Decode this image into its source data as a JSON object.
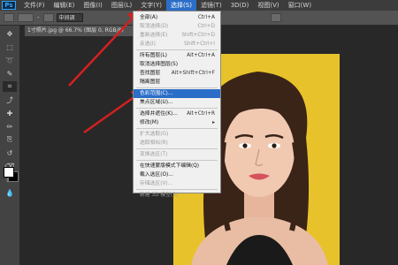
{
  "app_logo": "Ps",
  "menubar": {
    "items": [
      "文件(F)",
      "编辑(E)",
      "图像(I)",
      "图层(L)",
      "文字(Y)",
      "选择(S)",
      "滤镜(T)",
      "3D(D)",
      "视图(V)",
      "窗口(W)"
    ],
    "active_index": 5
  },
  "options_bar": {
    "size_label": "-",
    "mode_value": "中间调"
  },
  "document": {
    "tab_label": "1寸照片.jpg @ 66.7% (图层 0, RGB/8)"
  },
  "select_menu": {
    "items": [
      {
        "label": "全部(A)",
        "shortcut": "Ctrl+A",
        "disabled": false,
        "highlight": false
      },
      {
        "label": "取消选择(D)",
        "shortcut": "Ctrl+D",
        "disabled": true,
        "highlight": false
      },
      {
        "label": "重新选择(E)",
        "shortcut": "Shift+Ctrl+D",
        "disabled": true,
        "highlight": false
      },
      {
        "label": "反选(I)",
        "shortcut": "Shift+Ctrl+I",
        "disabled": true,
        "highlight": false
      },
      {
        "label": "所有图层(L)",
        "shortcut": "Alt+Ctrl+A",
        "disabled": false,
        "highlight": false
      },
      {
        "label": "取消选择图层(S)",
        "shortcut": "",
        "disabled": false,
        "highlight": false
      },
      {
        "label": "查找图层",
        "shortcut": "Alt+Shift+Ctrl+F",
        "disabled": false,
        "highlight": false
      },
      {
        "label": "隔离图层",
        "shortcut": "",
        "disabled": false,
        "highlight": false
      },
      {
        "label": "色彩范围(C)...",
        "shortcut": "",
        "disabled": false,
        "highlight": true
      },
      {
        "label": "焦点区域(U)...",
        "shortcut": "",
        "disabled": false,
        "highlight": false
      },
      {
        "label": "选择并遮住(K)...",
        "shortcut": "Alt+Ctrl+R",
        "disabled": false,
        "highlight": false
      },
      {
        "label": "修改(M)",
        "shortcut": "▸",
        "disabled": false,
        "highlight": false
      },
      {
        "label": "扩大选取(G)",
        "shortcut": "",
        "disabled": true,
        "highlight": false
      },
      {
        "label": "选取相似(R)",
        "shortcut": "",
        "disabled": true,
        "highlight": false
      },
      {
        "label": "变换选区(T)",
        "shortcut": "",
        "disabled": true,
        "highlight": false
      },
      {
        "label": "在快速蒙版模式下编辑(Q)",
        "shortcut": "",
        "disabled": false,
        "highlight": false
      },
      {
        "label": "载入选区(O)...",
        "shortcut": "",
        "disabled": false,
        "highlight": false
      },
      {
        "label": "存储选区(V)...",
        "shortcut": "",
        "disabled": true,
        "highlight": false
      },
      {
        "label": "新建 3D 模型(3)",
        "shortcut": "",
        "disabled": true,
        "highlight": false
      }
    ]
  },
  "colors": {
    "accent": "#2b6ec8",
    "arrow": "#d42020",
    "photo_bg": "#e8c22a",
    "foreground_swatch": "#ffffff",
    "background_swatch": "#000000"
  },
  "tools": [
    "move-tool-icon",
    "marquee-tool-icon",
    "lasso-tool-icon",
    "quick-select-tool-icon",
    "crop-tool-icon",
    "eyedropper-tool-icon",
    "healing-brush-tool-icon",
    "brush-tool-icon",
    "clone-stamp-tool-icon",
    "history-brush-tool-icon",
    "eraser-tool-icon",
    "gradient-tool-icon",
    "blur-tool-icon",
    "dodge-tool-icon",
    "pen-tool-icon",
    "type-tool-icon",
    "path-select-tool-icon",
    "rectangle-tool-icon",
    "hand-tool-icon",
    "zoom-tool-icon"
  ]
}
